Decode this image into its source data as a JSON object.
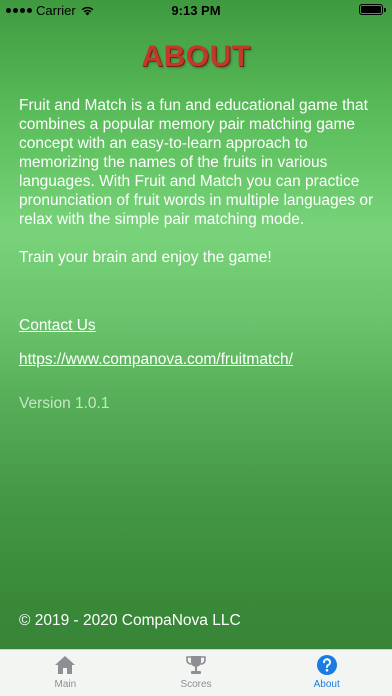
{
  "status_bar": {
    "carrier": "Carrier",
    "time": "9:13 PM"
  },
  "page": {
    "title": "ABOUT",
    "description_p1": "Fruit and Match is a fun and educational game that combines a popular memory pair matching game concept with an easy-to-learn approach to memorizing the names of the fruits in various languages. With Fruit and Match you can practice pronunciation of fruit words in multiple languages or relax with the simple pair matching mode.",
    "description_p2": "Train your brain and enjoy the game!",
    "contact_label": "Contact Us",
    "website_url": "https://www.companova.com/fruitmatch/",
    "version": "Version 1.0.1",
    "copyright": "© 2019 - 2020 CompaNova LLC"
  },
  "tab_bar": {
    "tabs": [
      {
        "label": "Main",
        "icon": "home-icon",
        "active": false
      },
      {
        "label": "Scores",
        "icon": "trophy-icon",
        "active": false
      },
      {
        "label": "About",
        "icon": "question-icon",
        "active": true
      }
    ]
  },
  "colors": {
    "title": "#c0392b",
    "active_tab": "#1a7ce0",
    "inactive_tab": "#8e8e93"
  }
}
